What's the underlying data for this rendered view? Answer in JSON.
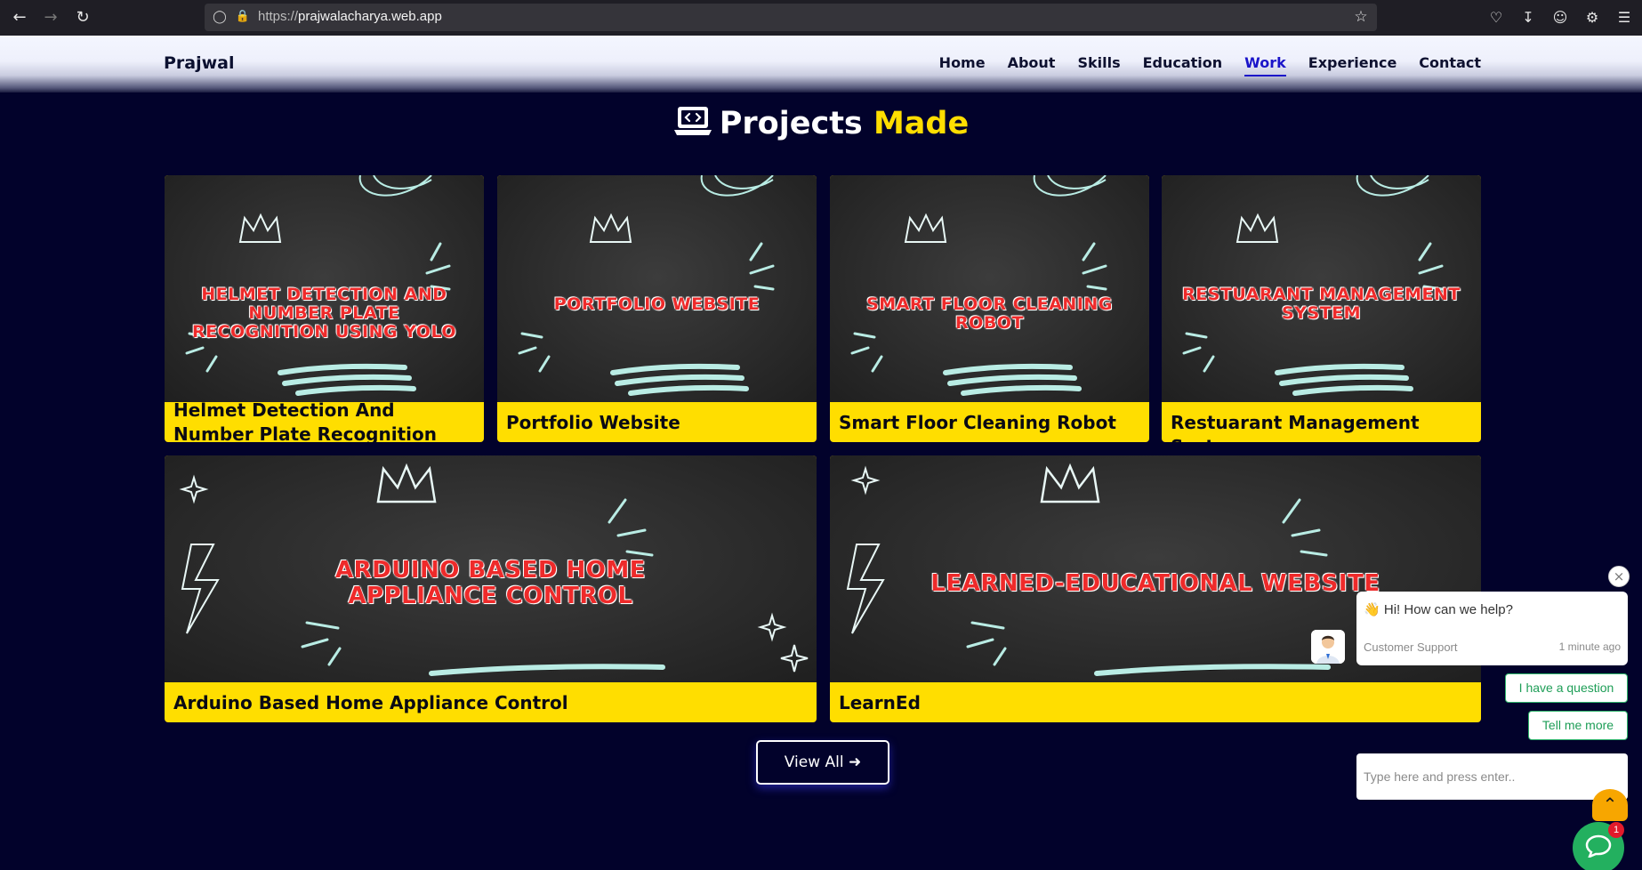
{
  "browser": {
    "url_prefix": "https://",
    "url_host": "prajwalacharya.web.app"
  },
  "site": {
    "brand": "Prajwal",
    "nav": [
      {
        "label": "Home",
        "active": false
      },
      {
        "label": "About",
        "active": false
      },
      {
        "label": "Skills",
        "active": false
      },
      {
        "label": "Education",
        "active": false
      },
      {
        "label": "Work",
        "active": true
      },
      {
        "label": "Experience",
        "active": false
      },
      {
        "label": "Contact",
        "active": false
      }
    ]
  },
  "section": {
    "title_main": "Projects",
    "title_accent": "Made",
    "icon": "laptop-code-icon",
    "accent_color": "#ffde00"
  },
  "projects": [
    {
      "thumb_text": "Helmet Detection and Number Plate Recognition using YOLO",
      "caption": "Helmet Detection And Number Plate Recognition Using YOLO"
    },
    {
      "thumb_text": "Portfolio Website",
      "caption": "Portfolio Website"
    },
    {
      "thumb_text": "Smart Floor Cleaning Robot",
      "caption": "Smart Floor Cleaning Robot"
    },
    {
      "thumb_text": "Restuarant Management System",
      "caption": "Restuarant Management System"
    },
    {
      "thumb_text": "Arduino Based Home Appliance Control",
      "caption": "Arduino Based Home Appliance Control"
    },
    {
      "thumb_text": "LearnEd-Educational Website",
      "caption": "LearnEd"
    }
  ],
  "view_all": {
    "label": "View All",
    "icon": "arrow-right-icon"
  },
  "chat": {
    "message": "Hi! How can we help?",
    "wave_icon": "wave-hand-icon",
    "agent": "Customer Support",
    "time": "1 minute ago",
    "options": [
      "I have a question",
      "Tell me more"
    ],
    "input_placeholder": "Type here and press enter..",
    "badge_count": "1",
    "launcher_color": "#23b05f"
  }
}
